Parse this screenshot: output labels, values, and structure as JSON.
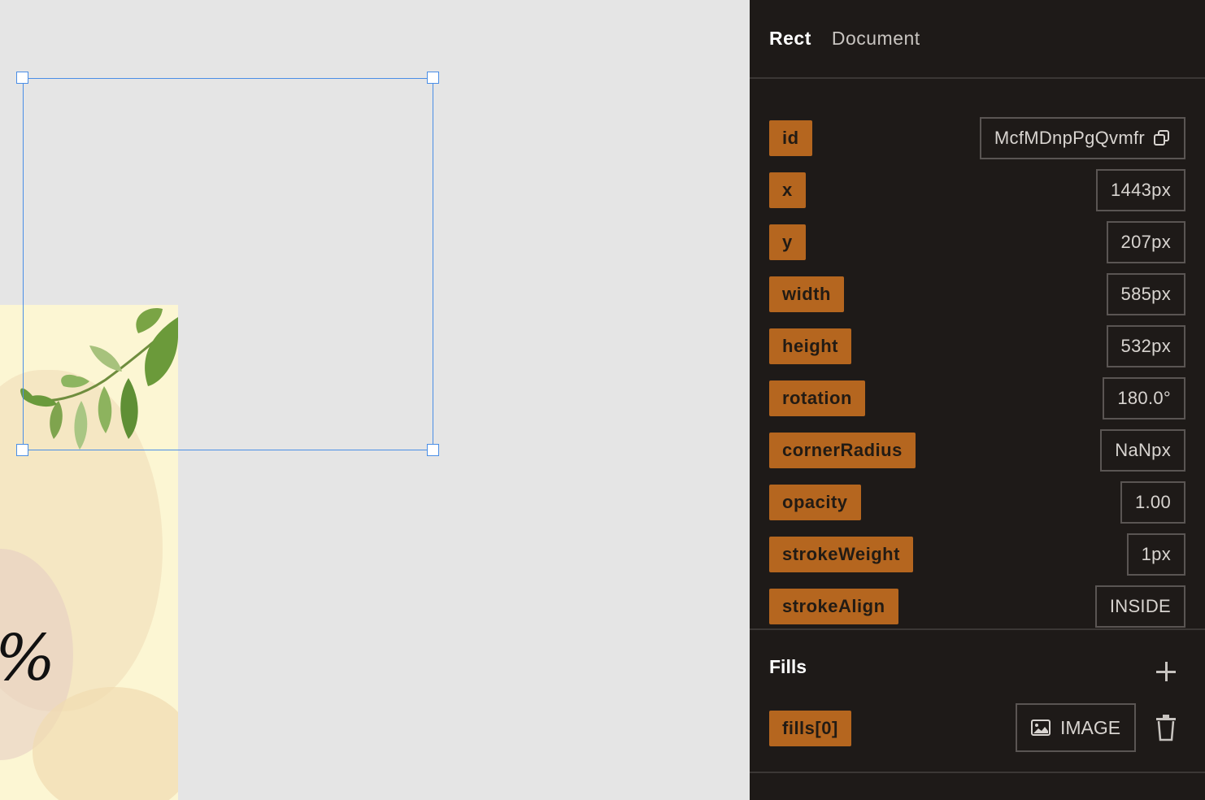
{
  "panel": {
    "tabs": [
      {
        "label": "Rect",
        "active": true
      },
      {
        "label": "Document",
        "active": false
      }
    ],
    "properties": [
      {
        "label": "id",
        "value": "McfMDnpPgQvmfr"
      },
      {
        "label": "x",
        "value": "1443px"
      },
      {
        "label": "y",
        "value": "207px"
      },
      {
        "label": "width",
        "value": "585px"
      },
      {
        "label": "height",
        "value": "532px"
      },
      {
        "label": "rotation",
        "value": "180.0°"
      },
      {
        "label": "cornerRadius",
        "value": "NaNpx"
      },
      {
        "label": "opacity",
        "value": "1.00"
      },
      {
        "label": "strokeWeight",
        "value": "1px"
      },
      {
        "label": "strokeAlign",
        "value": "INSIDE"
      }
    ],
    "fills": {
      "title": "Fills",
      "items": [
        {
          "label": "fills[0]",
          "type": "IMAGE"
        }
      ]
    }
  },
  "canvas": {
    "partial_text": "%"
  },
  "colors": {
    "label_bg": "#b5661f",
    "panel_bg": "#1e1a18",
    "selection": "#4a8ee6",
    "canvas_bg": "#e5e5e5"
  }
}
